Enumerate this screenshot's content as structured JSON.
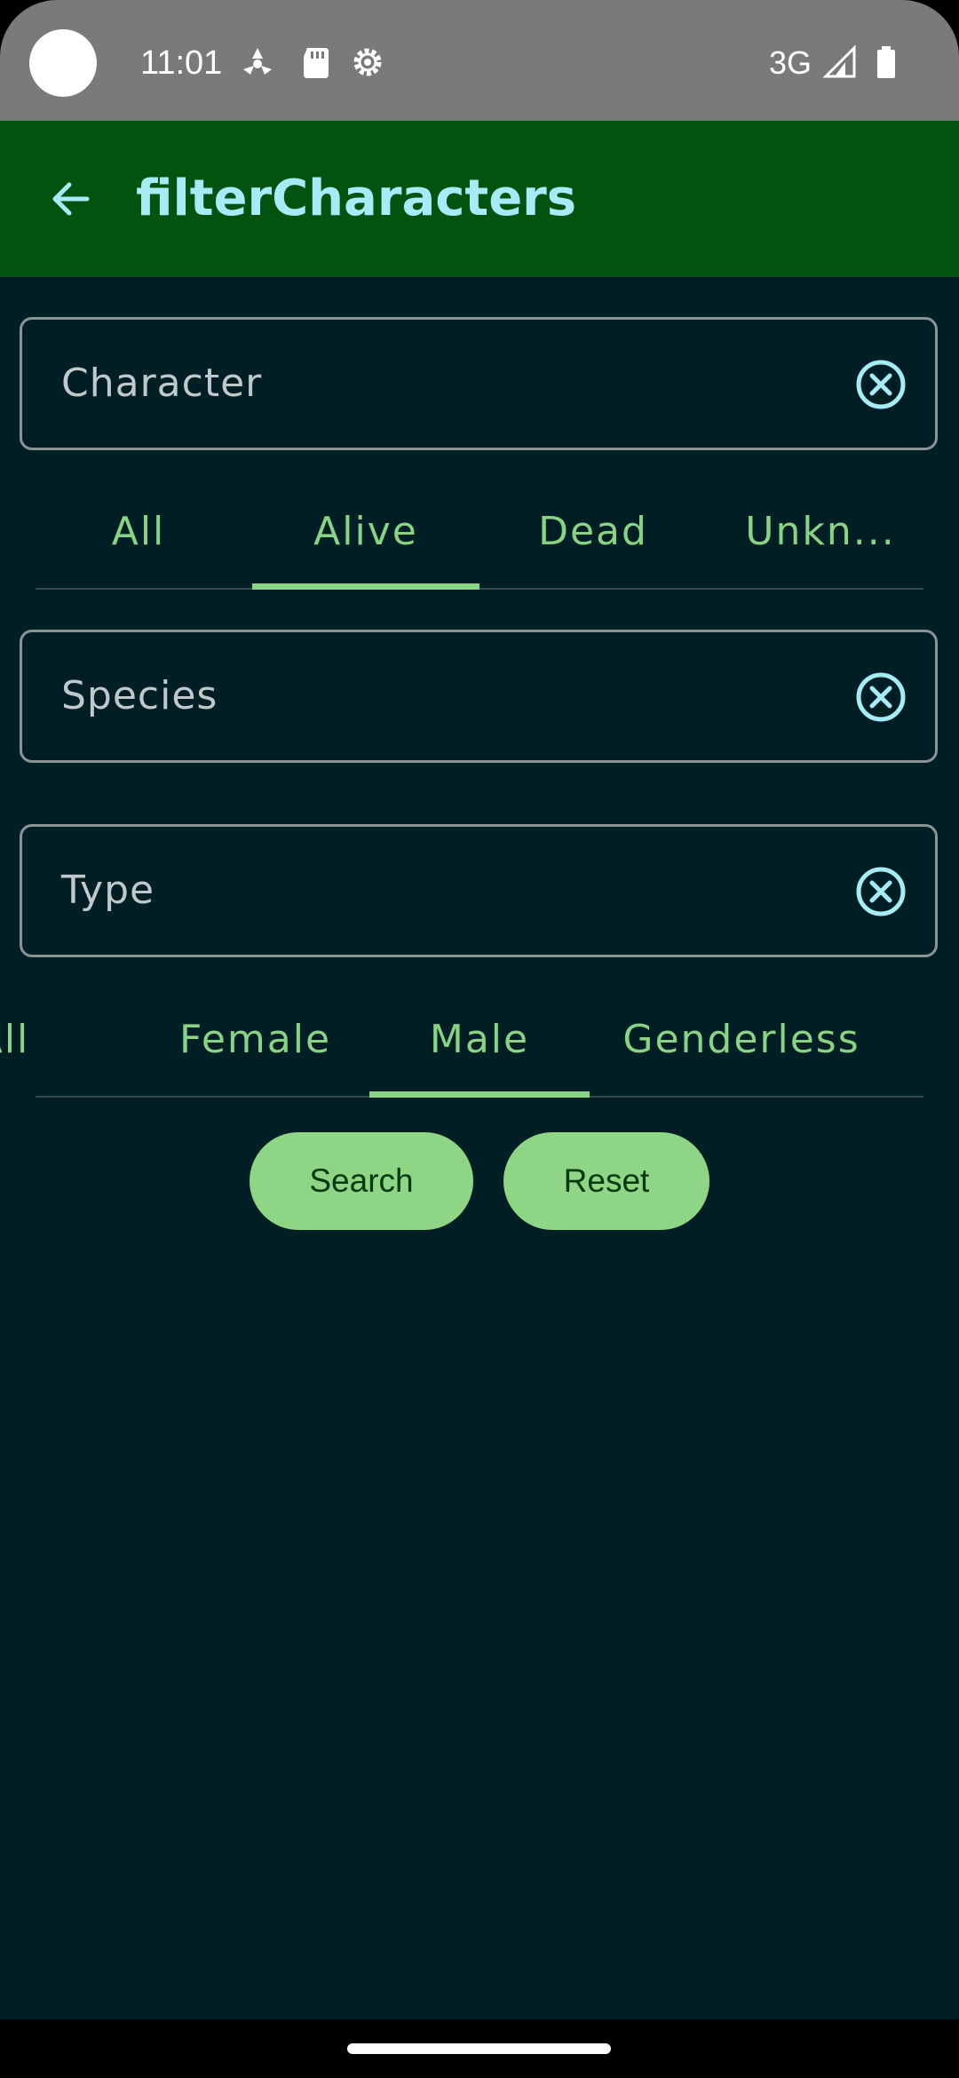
{
  "status_bar": {
    "time": "11:01",
    "network": "3G",
    "icons": [
      "fan-icon",
      "sd-card-icon",
      "settings-gear-icon",
      "signal-icon",
      "battery-icon"
    ]
  },
  "app_bar": {
    "title": "filterCharacters",
    "back_icon": "arrow-left-icon"
  },
  "fields": {
    "character": {
      "placeholder": "Character",
      "value": ""
    },
    "species": {
      "placeholder": "Species",
      "value": ""
    },
    "type": {
      "placeholder": "Type",
      "value": ""
    }
  },
  "status_tabs": {
    "items": [
      "All",
      "Alive",
      "Dead",
      "Unkn..."
    ],
    "selected": "Alive"
  },
  "gender_tabs": {
    "items": [
      "All",
      "Female",
      "Male",
      "Genderless"
    ],
    "selected": "Male"
  },
  "actions": {
    "search_label": "Search",
    "reset_label": "Reset"
  },
  "colors": {
    "background": "#001f25",
    "app_bar": "#02530f",
    "title": "#a5ecf6",
    "accent": "#89d385",
    "button": "#8ed685",
    "outline": "#8b9495"
  }
}
